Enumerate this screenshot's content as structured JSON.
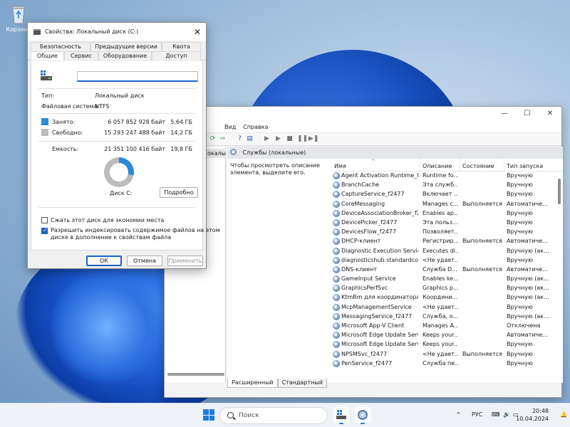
{
  "desktop": {
    "recycle_bin_label": "Корзина"
  },
  "props": {
    "title": "Свойства: Локальный диск (C:)",
    "tabs_row1": [
      "Безопасность",
      "Предыдущие версии",
      "Квота"
    ],
    "tabs_row2": [
      "Общие",
      "Сервис",
      "Оборудование",
      "Доступ"
    ],
    "active_tab": "Общие",
    "name_value": "",
    "type_label": "Тип:",
    "type_value": "Локальный диск",
    "fs_label": "Файловая система:",
    "fs_value": "NTFS",
    "used_label": "Занято:",
    "used_bytes": "6 057 852 928 байт",
    "used_gb": "5,64 ГБ",
    "free_label": "Свободно:",
    "free_bytes": "15 293 247 488 байт",
    "free_gb": "14,2 ГБ",
    "capacity_label": "Емкость:",
    "capacity_bytes": "21 351 100 416 байт",
    "capacity_gb": "19,8 ГБ",
    "used_fraction": 0.284,
    "disk_label": "Диск C:",
    "details_button": "Подробно",
    "compress_label": "Сжать этот диск для экономии места",
    "compress_checked": false,
    "index_label_1": "Разрешить индексировать содержимое файлов на этом",
    "index_label_2": "диске в дополнение к свойствам файла",
    "index_checked": true,
    "ok": "ОК",
    "cancel": "Отмена",
    "apply": "Применить",
    "colors": {
      "used": "#2b8ad8",
      "free": "#bcbcbc"
    }
  },
  "services": {
    "menu": [
      "Вид",
      "Справка"
    ],
    "tree_selected": "окалы",
    "pane_title": "Службы (локальные)",
    "description": "Чтобы просмотреть описание элемента, выделите его.",
    "columns": [
      "Имя",
      "Описание",
      "Состояние",
      "Тип запуска"
    ],
    "rows": [
      {
        "name": "Agent Activation Runtime_f...",
        "desc": "Runtime fo...",
        "state": "",
        "start": "Вручную"
      },
      {
        "name": "BranchCache",
        "desc": "Эта служб...",
        "state": "",
        "start": "Вручную"
      },
      {
        "name": "CaptureService_f2477",
        "desc": "Включает ...",
        "state": "",
        "start": "Вручную"
      },
      {
        "name": "CoreMessaging",
        "desc": "Manages c...",
        "state": "Выполняется",
        "start": "Автоматиче..."
      },
      {
        "name": "DeviceAssociationBroker_f2...",
        "desc": "Enables ap...",
        "state": "",
        "start": "Вручную"
      },
      {
        "name": "DevicePicker_f2477",
        "desc": "Эта польз...",
        "state": "",
        "start": "Вручную"
      },
      {
        "name": "DevicesFlow_f2477",
        "desc": "Позволяет...",
        "state": "",
        "start": "Вручную"
      },
      {
        "name": "DHCP-клиент",
        "desc": "Регистрир...",
        "state": "Выполняется",
        "start": "Автоматиче..."
      },
      {
        "name": "Diagnostic Execution Service",
        "desc": "Executes di...",
        "state": "",
        "start": "Вручную (ак..."
      },
      {
        "name": "diagnosticshub.standardcol...",
        "desc": "<Не удает...",
        "state": "",
        "start": "Вручную"
      },
      {
        "name": "DNS-клиент",
        "desc": "Служба D...",
        "state": "Выполняется",
        "start": "Автоматиче..."
      },
      {
        "name": "GameInput Service",
        "desc": "Enables ke...",
        "state": "",
        "start": "Вручную (ак..."
      },
      {
        "name": "GraphicsPerfSvc",
        "desc": "Graphics p...",
        "state": "",
        "start": "Вручную (ак..."
      },
      {
        "name": "KtmRm для координатора ...",
        "desc": "Координи...",
        "state": "",
        "start": "Вручную (ак..."
      },
      {
        "name": "McpManagementService",
        "desc": "<Не удает...",
        "state": "",
        "start": "Вручную"
      },
      {
        "name": "MessagingService_f2477",
        "desc": "Служба, о...",
        "state": "",
        "start": "Вручную (ак..."
      },
      {
        "name": "Microsoft App-V Client",
        "desc": "Manages A...",
        "state": "",
        "start": "Отключена"
      },
      {
        "name": "Microsoft Edge Update Serv...",
        "desc": "Keeps your...",
        "state": "",
        "start": "Автоматиче..."
      },
      {
        "name": "Microsoft Edge Update Serv...",
        "desc": "Keeps your...",
        "state": "",
        "start": "Вручную"
      },
      {
        "name": "NPSMSvc_f2477",
        "desc": "<Не удает...",
        "state": "Выполняется",
        "start": "Вручную"
      },
      {
        "name": "PenService_f2477",
        "desc": "Служба пе...",
        "state": "",
        "start": "Вручную"
      }
    ],
    "tabs": [
      "Расширенный",
      "Стандартный"
    ],
    "active_tab": "Расширенный"
  },
  "taskbar": {
    "search_placeholder": "Поиск",
    "lang": "РУС",
    "time": "20:48",
    "date": "10.04.2024"
  }
}
